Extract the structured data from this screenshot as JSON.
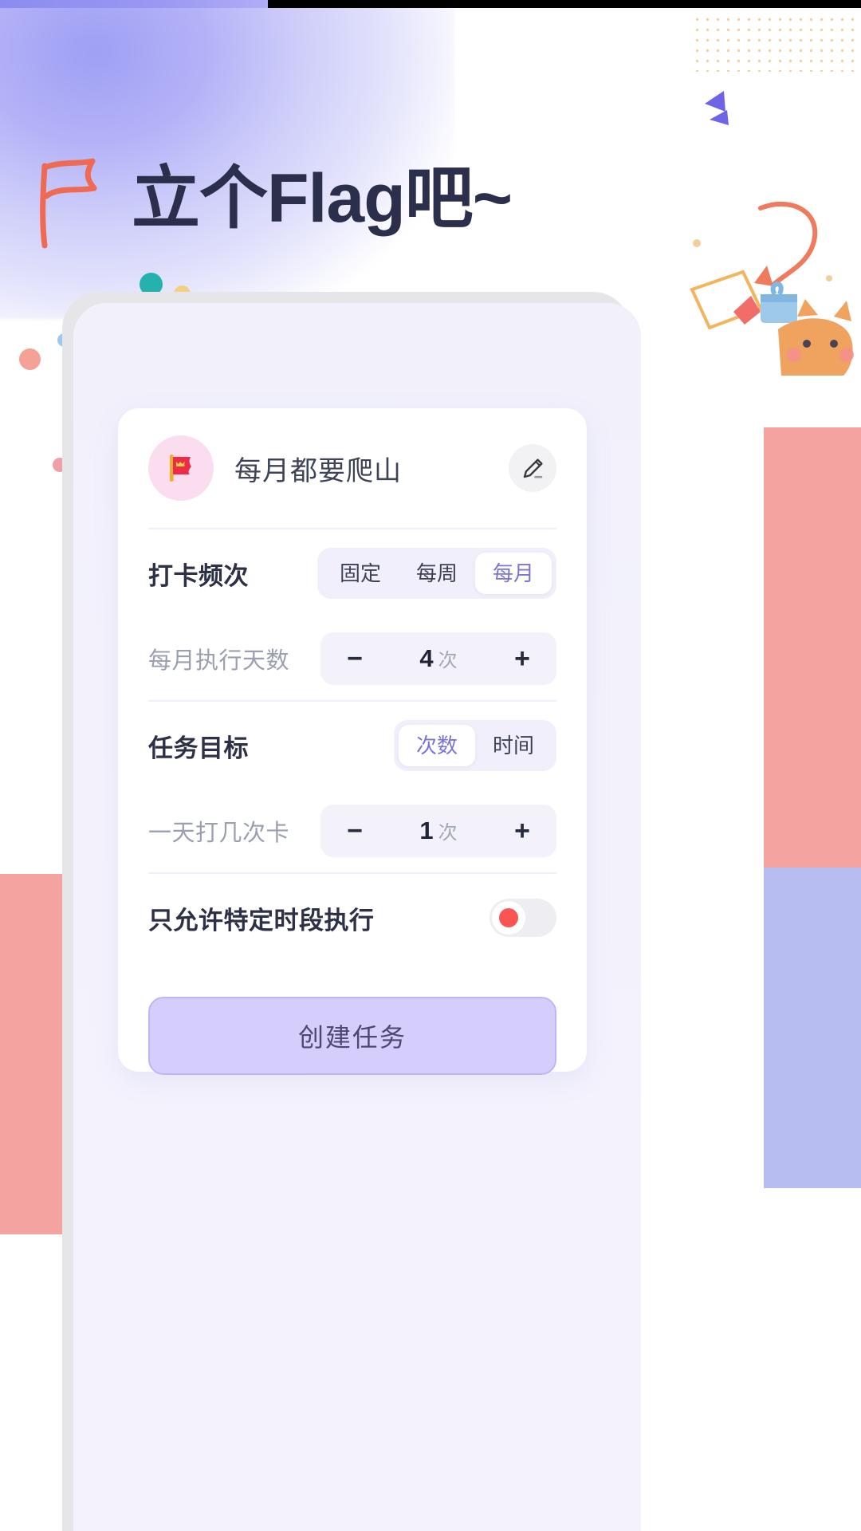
{
  "page": {
    "headline": "立个Flag吧~",
    "accent_purple": "#7a73d8",
    "accent_coral": "#f0705d",
    "title_color": "#2b2f4c",
    "button_fill": "#d5cdfb"
  },
  "decor": {
    "flag_doodle": "flag-doodle-icon",
    "chevron": "double-chevron-icon",
    "dot_grid": "dot-grid-pattern",
    "arrow": "curved-arrow-icon",
    "gift": "gift-box-icon",
    "cat": "cat-illustration"
  },
  "card": {
    "task": {
      "icon": "red-flag-icon",
      "name": "每月都要爬山",
      "edit_icon": "pencil-icon"
    },
    "frequency": {
      "label": "打卡频次",
      "options": [
        "固定",
        "每周",
        "每月"
      ],
      "selected": "每月"
    },
    "frequency_count": {
      "label": "每月执行天数",
      "decrease": "−",
      "increase": "+",
      "value": "4",
      "unit": "次"
    },
    "goal": {
      "label": "任务目标",
      "options": [
        "次数",
        "时间"
      ],
      "selected": "次数"
    },
    "goal_count": {
      "label": "一天打几次卡",
      "decrease": "−",
      "increase": "+",
      "value": "1",
      "unit": "次"
    },
    "time_limit": {
      "label": "只允许特定时段执行",
      "enabled": false
    },
    "submit": {
      "label": "创建任务"
    }
  }
}
